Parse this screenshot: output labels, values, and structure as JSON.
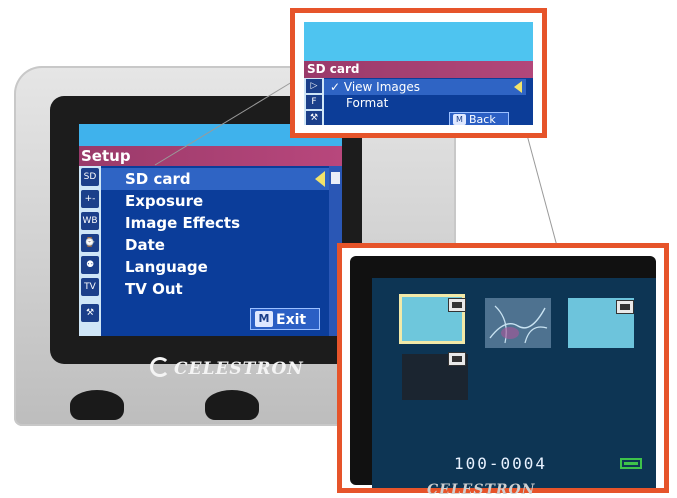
{
  "camera": {
    "brand": "CELESTRON",
    "setup_title": "Setup",
    "menu_items": [
      {
        "label": "SD card",
        "icon": "sd-card-icon",
        "icon_text": "SD",
        "selected": true
      },
      {
        "label": "Exposure",
        "icon": "exposure-icon",
        "icon_text": "+-",
        "selected": false
      },
      {
        "label": "Image Effects",
        "icon": "white-balance-icon",
        "icon_text": "WB",
        "selected": false
      },
      {
        "label": "Date",
        "icon": "clock-icon",
        "icon_text": "⌚",
        "selected": false
      },
      {
        "label": "Language",
        "icon": "language-icon",
        "icon_text": "⚉",
        "selected": false
      },
      {
        "label": "TV Out",
        "icon": "tv-icon",
        "icon_text": "TV",
        "selected": false
      }
    ],
    "bottom_icon": "tools-icon",
    "exit_key": "M",
    "exit_label": "Exit"
  },
  "sd_card_zoom": {
    "title": "SD card",
    "items": [
      {
        "label": "✓ View Images",
        "icon": "play-icon",
        "icon_text": "▷",
        "selected": true
      },
      {
        "label": "Format",
        "icon": "format-icon",
        "icon_text": "F",
        "selected": false
      }
    ],
    "bottom_icon": "tools-icon",
    "back_key": "M",
    "back_label": "Back"
  },
  "gallery_zoom": {
    "counter": "100-0004",
    "thumbnails": [
      {
        "name": "image-1",
        "video": true,
        "selected": true
      },
      {
        "name": "image-2",
        "video": false,
        "selected": false
      },
      {
        "name": "image-3",
        "video": true,
        "selected": false
      },
      {
        "name": "image-4",
        "video": true,
        "selected": false
      }
    ],
    "brand": "CELESTRON",
    "battery": "full"
  },
  "colors": {
    "accent_border": "#e6542a",
    "menu_bg": "#0c3d98",
    "menu_selected": "#2f64c4",
    "title_bar": "#9a3a6a",
    "arrow": "#f2e36a",
    "battery": "#3ec24a"
  }
}
